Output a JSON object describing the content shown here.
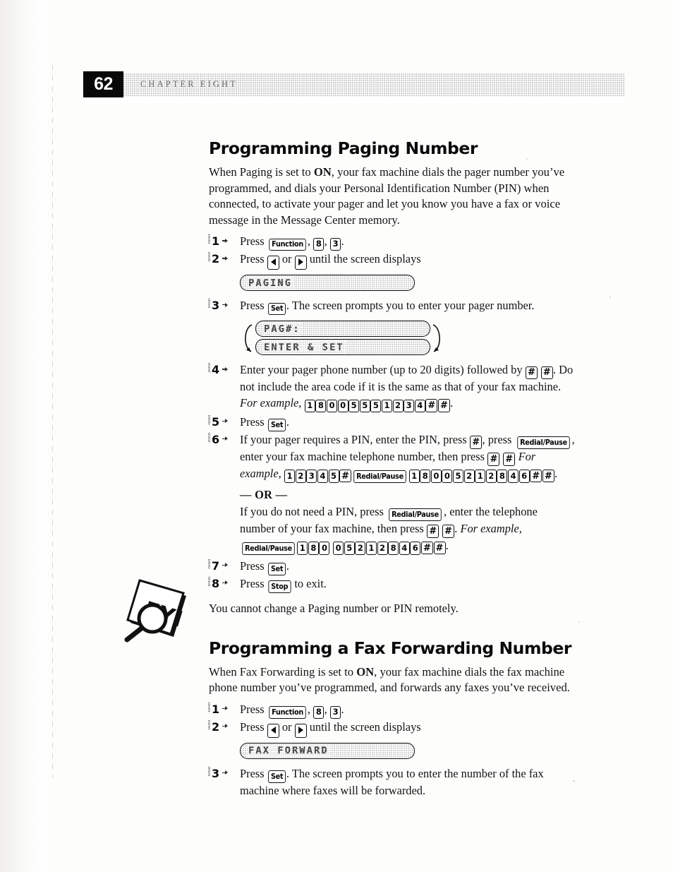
{
  "header": {
    "page_number": "62",
    "chapter_label": "CHAPTER EIGHT"
  },
  "sections": [
    {
      "id": "paging",
      "title": "Programming Paging Number",
      "intro_parts": {
        "a": "When Paging is set to ",
        "b": "ON",
        "c": ", your fax machine dials the pager number you’ve programmed, and dials your Personal Identification Number (PIN) when connected, to activate your pager and let you know you have a fax or voice message in the Message Center memory."
      },
      "steps": {
        "s1": {
          "num": "1",
          "press": "Press",
          "keys": [
            "Function",
            "8",
            "3"
          ],
          "tail": "."
        },
        "s2": {
          "num": "2",
          "press": "Press",
          "or": "or",
          "tail": "until the screen displays",
          "lcd": "PAGING"
        },
        "s3": {
          "num": "3",
          "press": "Press",
          "key": "Set",
          "tail": ". The screen prompts you to enter your pager number.",
          "lcd_line1": "PAG#:",
          "lcd_line2": "ENTER & SET"
        },
        "s4": {
          "num": "4",
          "text_a": "Enter your pager phone number (up to 20 digits) followed by",
          "text_b": ". Do not include the area code if it is the same as that of your fax machine.",
          "example_label": "For example,",
          "keys_after": [
            "#",
            "#"
          ],
          "sequence": [
            "1",
            "8",
            "0",
            "0",
            "5",
            "5",
            "5",
            "1",
            "2",
            "3",
            "4",
            "#",
            "#"
          ],
          "tail": "."
        },
        "s5": {
          "num": "5",
          "press": "Press",
          "key": "Set",
          "tail": "."
        },
        "s6": {
          "num": "6",
          "text_a": "If your pager requires a PIN, enter the PIN, press",
          "key_hash": "#",
          "text_b": ", press",
          "key_redial": "Redial/Pause",
          "text_c": ", enter your fax machine telephone number, then press",
          "keys_hh": [
            "#",
            "#"
          ],
          "example_label": "For example,",
          "sequence": [
            "1",
            "2",
            "3",
            "4",
            "5",
            "#",
            "Redial/Pause",
            "1",
            "8",
            "0",
            "0",
            "5",
            "2",
            "1",
            "2",
            "8",
            "4",
            "6",
            "#",
            "#"
          ],
          "tail": "."
        },
        "or_divider": "— OR —",
        "or_block": {
          "text_a": "If you do not need a PIN, press",
          "key_redial": "Redial/Pause",
          "text_b": ", enter the telephone number of your fax machine, then press",
          "keys_hh": [
            "#",
            "#"
          ],
          "text_c": ".",
          "example_label": "For example,",
          "sequence": [
            "Redial/Pause",
            "1",
            "8",
            "0",
            "0",
            "5",
            "2",
            "1",
            "2",
            "8",
            "4",
            "6",
            "#",
            "#"
          ],
          "tail": "."
        },
        "s7": {
          "num": "7",
          "press": "Press",
          "key": "Set",
          "tail": "."
        },
        "s8": {
          "num": "8",
          "press": "Press",
          "key": "Stop",
          "tail": "to exit."
        }
      },
      "note": "You cannot change a Paging number or PIN remotely."
    },
    {
      "id": "fax-forwarding",
      "title": "Programming a Fax Forwarding Number",
      "intro_parts": {
        "a": "When Fax Forwarding is set to ",
        "b": "ON",
        "c": ", your fax machine dials the fax machine phone number you’ve programmed, and forwards any faxes you’ve received."
      },
      "steps": {
        "s1": {
          "num": "1",
          "press": "Press",
          "keys": [
            "Function",
            "8",
            "3"
          ],
          "tail": "."
        },
        "s2": {
          "num": "2",
          "press": "Press",
          "or": "or",
          "tail": "until the screen displays",
          "lcd": "FAX FORWARD"
        },
        "s3": {
          "num": "3",
          "press": "Press",
          "key": "Set",
          "tail": ". The screen prompts you to enter the number of the fax machine where faxes will be forwarded."
        }
      }
    }
  ],
  "icons": {
    "fyi_label": "FYI"
  },
  "colors": {
    "ink": "#111111",
    "page_background": "#fdfdfc",
    "page_number_background": "#080808"
  }
}
